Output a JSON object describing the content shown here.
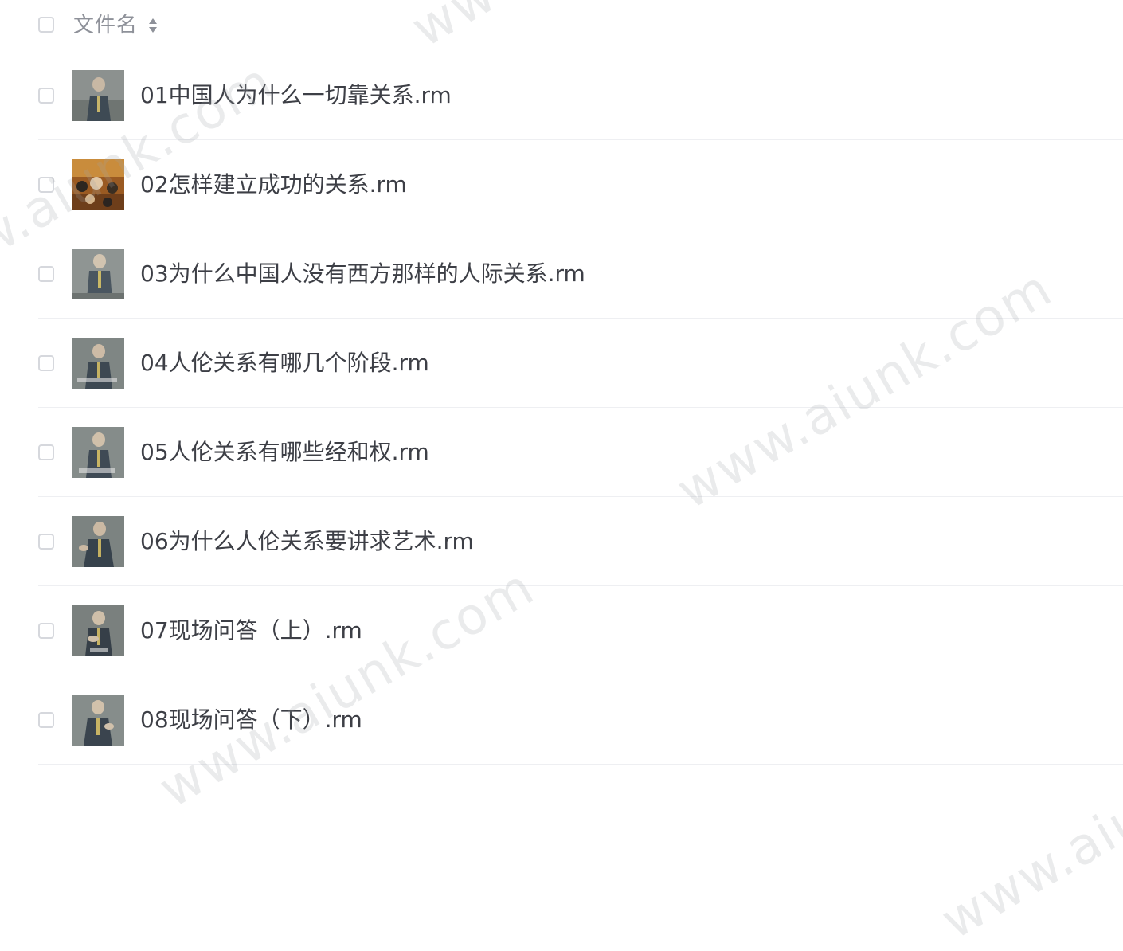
{
  "header": {
    "column_label": "文件名",
    "sort_icon": "sort-up-down-icon"
  },
  "files": [
    {
      "name": "01中国人为什么一切靠关系.rm",
      "thumbnail": "video-thumbnail"
    },
    {
      "name": "02怎样建立成功的关系.rm",
      "thumbnail": "video-thumbnail"
    },
    {
      "name": "03为什么中国人没有西方那样的人际关系.rm",
      "thumbnail": "video-thumbnail"
    },
    {
      "name": "04人伦关系有哪几个阶段.rm",
      "thumbnail": "video-thumbnail"
    },
    {
      "name": "05人伦关系有哪些经和权.rm",
      "thumbnail": "video-thumbnail"
    },
    {
      "name": "06为什么人伦关系要讲求艺术.rm",
      "thumbnail": "video-thumbnail"
    },
    {
      "name": "07现场问答（上）.rm",
      "thumbnail": "video-thumbnail"
    },
    {
      "name": "08现场问答（下）.rm",
      "thumbnail": "video-thumbnail"
    }
  ],
  "watermarks": [
    "www.aiunk.com",
    "www.aiunk.com",
    "www.aiunk.com",
    "www.aiunk.com",
    "www.aiunk.com"
  ],
  "colors": {
    "text": "#3d3f46",
    "header_text": "#8e9199",
    "divider": "#eeeff2",
    "checkbox_border": "#d6d8dd"
  }
}
